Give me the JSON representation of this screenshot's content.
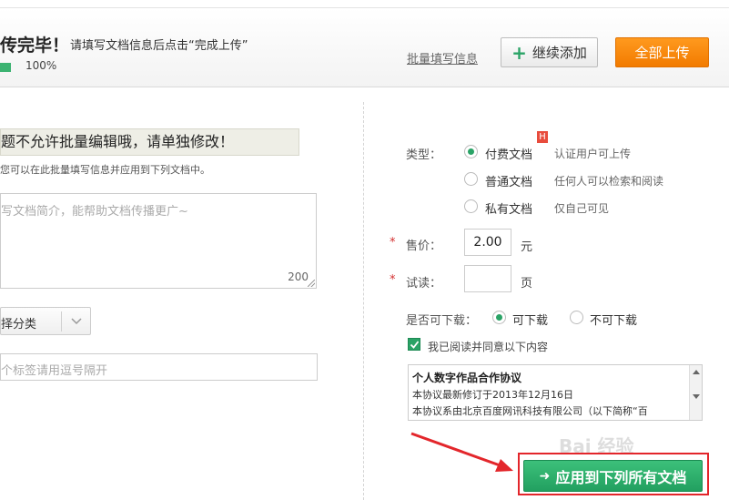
{
  "header": {
    "title": "传完毕！",
    "subtitle": "请填写文档信息后点击“完成上传”",
    "progress_text": "100%",
    "progress_value": 1.0,
    "batch_link": "批量填写信息",
    "continue_button": "继续添加",
    "upload_all_button": "全部上传"
  },
  "left": {
    "warning": "题不允许批量编辑哦，请单独修改！",
    "hint": "您可以在此批量填写信息并应用到下列文档中。",
    "summary_placeholder": "写文档简介，能帮助文档传播更广~",
    "summary_count": "200",
    "category_label": "择分类",
    "tags_placeholder": "个标签请用逗号隔开"
  },
  "right": {
    "type_label": "类型：",
    "type_options": [
      {
        "label": "付费文档",
        "desc": "认证用户可上传",
        "selected": true
      },
      {
        "label": "普通文档",
        "desc": "任何人可以检索和阅读",
        "selected": false
      },
      {
        "label": "私有文档",
        "desc": "仅自己可见",
        "selected": false
      }
    ],
    "badge": "H",
    "price_label": "售价：",
    "price_value": "2.00",
    "price_unit": "元",
    "trial_label": "试读：",
    "trial_value": "",
    "trial_unit": "页",
    "download_label": "是否可下载：",
    "download_options": [
      {
        "label": "可下载",
        "selected": true
      },
      {
        "label": "不可下载",
        "selected": false
      }
    ],
    "agree_label": "我已阅读并同意以下内容",
    "agreement_title": "个人数字作品合作协议",
    "agreement_line1": "本协议最新修订于2013年12月16日",
    "agreement_line2": "本协议系由北京百度网讯科技有限公司（以下简称“百"
  },
  "apply_button": "应用到下列所有文档",
  "watermark": "Bai 经验",
  "colors": {
    "accent_green": "#2aa366",
    "orange": "#f27b00",
    "red": "#e3262b"
  }
}
